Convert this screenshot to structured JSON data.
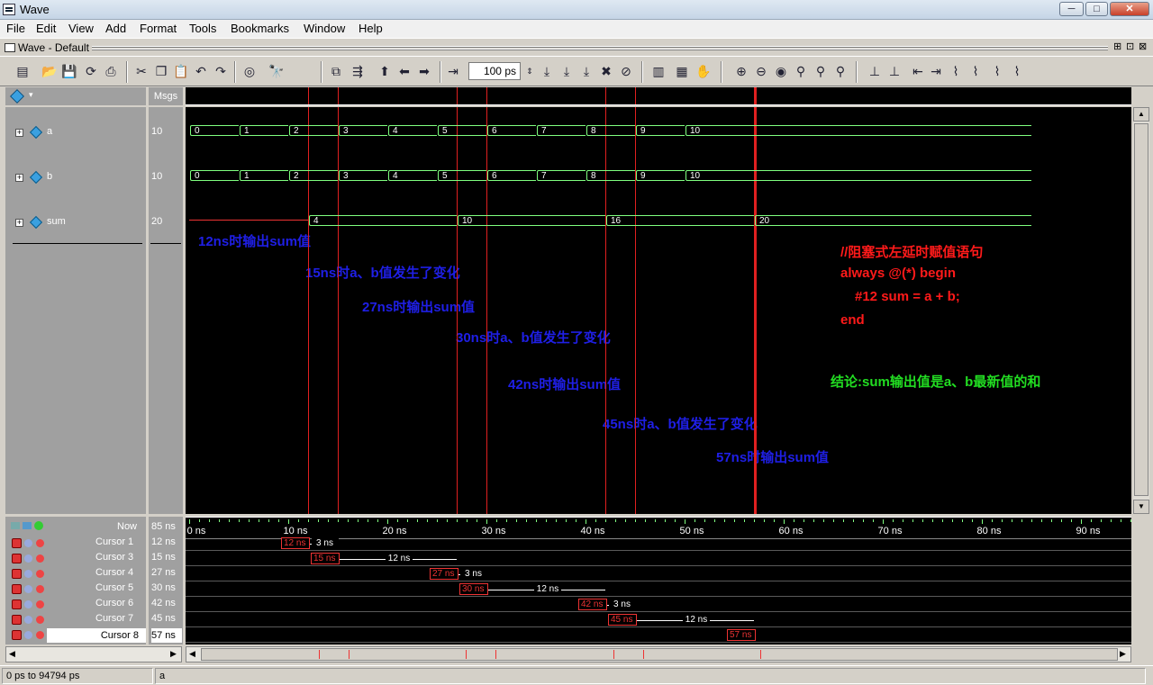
{
  "window": {
    "title": "Wave",
    "min": "─",
    "max": "□",
    "close": "✕"
  },
  "menu": [
    "File",
    "Edit",
    "View",
    "Add",
    "Format",
    "Tools",
    "Bookmarks",
    "Window",
    "Help"
  ],
  "doc": {
    "title": "Wave - Default"
  },
  "toolbar": {
    "zoom_value": "100",
    "zoom_unit": "ps"
  },
  "panes": {
    "msgs_header": "Msgs"
  },
  "signals": [
    {
      "name": "a",
      "value": "10",
      "segments": [
        "0",
        "1",
        "2",
        "3",
        "4",
        "5",
        "6",
        "7",
        "8",
        "9",
        "10"
      ]
    },
    {
      "name": "b",
      "value": "10",
      "segments": [
        "0",
        "1",
        "2",
        "3",
        "4",
        "5",
        "6",
        "7",
        "8",
        "9",
        "10"
      ]
    },
    {
      "name": "sum",
      "value": "20",
      "segments": [
        "4",
        "10",
        "16",
        "20"
      ]
    }
  ],
  "annotations": {
    "blue": [
      "12ns时输出sum值",
      "15ns时a、b值发生了变化",
      "27ns时输出sum值",
      "30ns时a、b值发生了变化",
      "42ns时输出sum值",
      "45ns时a、b值发生了变化",
      "57ns时输出sum值"
    ],
    "code": [
      "//阻塞式左延时赋值语句",
      "always @(*) begin",
      "#12 sum = a + b;",
      "end"
    ],
    "conclusion": "结论:sum输出值是a、b最新值的和"
  },
  "timeline": {
    "now_label": "Now",
    "now_value": "85 ns",
    "ticks": [
      "0 ns",
      "10 ns",
      "20 ns",
      "30 ns",
      "40 ns",
      "50 ns",
      "60 ns",
      "70 ns",
      "80 ns",
      "90 ns"
    ]
  },
  "cursors": [
    {
      "name": "Cursor 1",
      "value": "12 ns",
      "box": "12 ns",
      "delta": "3 ns"
    },
    {
      "name": "Cursor 3",
      "value": "15 ns",
      "box": "15 ns",
      "delta": "12 ns"
    },
    {
      "name": "Cursor 4",
      "value": "27 ns",
      "box": "27 ns",
      "delta": "3 ns"
    },
    {
      "name": "Cursor 5",
      "value": "30 ns",
      "box": "30 ns",
      "delta": "12 ns"
    },
    {
      "name": "Cursor 6",
      "value": "42 ns",
      "box": "42 ns",
      "delta": "3 ns"
    },
    {
      "name": "Cursor 7",
      "value": "45 ns",
      "box": "45 ns",
      "delta": "12 ns"
    },
    {
      "name": "Cursor 8",
      "value": "57 ns",
      "box": "57 ns",
      "delta": ""
    }
  ],
  "status": {
    "range": "0 ps to 94794 ps",
    "selected": "a"
  },
  "colors": {
    "annotation_blue": "#1f1fe6",
    "annotation_red": "#ff1a1a",
    "annotation_green": "#22dd22",
    "wave_green": "#7fff7f",
    "cursor_red": "#e02020"
  }
}
